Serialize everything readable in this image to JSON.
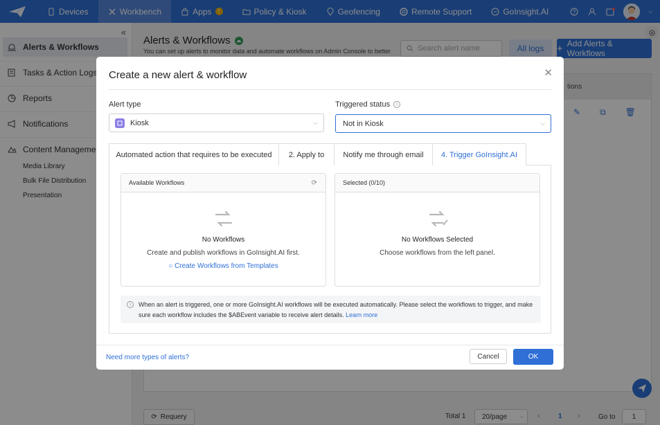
{
  "nav": {
    "items": [
      {
        "label": "Devices",
        "icon": "device-icon"
      },
      {
        "label": "Workbench",
        "icon": "tools-icon"
      },
      {
        "label": "Apps",
        "icon": "bag-icon",
        "badge": "!"
      },
      {
        "label": "Policy & Kiosk",
        "icon": "folder-icon"
      },
      {
        "label": "Geofencing",
        "icon": "location-icon"
      },
      {
        "label": "Remote Support",
        "icon": "support-icon"
      },
      {
        "label": "GoInsight.AI",
        "icon": "ai-icon"
      }
    ],
    "active_index": 1
  },
  "sidebar": {
    "items": [
      {
        "label": "Alerts & Workflows",
        "icon": "alert-icon"
      },
      {
        "label": "Tasks & Action Logs",
        "icon": "tasks-icon"
      },
      {
        "label": "Reports",
        "icon": "reports-icon"
      },
      {
        "label": "Notifications",
        "icon": "megaphone-icon"
      },
      {
        "label": "Content Management",
        "icon": "content-icon"
      }
    ],
    "sub_items": [
      "Media Library",
      "Bulk File Distribution",
      "Presentation"
    ]
  },
  "main": {
    "title": "Alerts & Workflows",
    "description": "You can set up alerts to monitor data and automate workflows on Admin Console to better",
    "search_placeholder": "Search alert name",
    "all_logs_label": "All logs",
    "add_button_label": "Add Alerts & Workflows",
    "actions_header": "tions"
  },
  "pagination": {
    "requery_label": "Requery",
    "total_label": "Total 1",
    "page_size": "20/page",
    "current_page": "1",
    "goto_label": "Go to",
    "goto_value": "1"
  },
  "modal": {
    "title": "Create a new alert & workflow",
    "alert_type_label": "Alert type",
    "alert_type_value": "Kiosk",
    "triggered_status_label": "Triggered status",
    "triggered_status_value": "Not in Kiosk",
    "tabs": [
      "Automated action that requires to be executed",
      "2. Apply to",
      "Notify me through email",
      "4. Trigger GoInsight.AI"
    ],
    "active_tab": 3,
    "available": {
      "header": "Available Workflows",
      "empty_title": "No Workflows",
      "empty_desc": "Create and publish workflows in GoInsight.AI first.",
      "link": "Create Workflows from Templates"
    },
    "selected": {
      "header": "Selected (0/10)",
      "empty_title": "No Workflows Selected",
      "empty_desc": "Choose workflows from the left panel."
    },
    "info_text": "When an alert is triggered, one or more GoInsight.AI workflows will be executed automatically. Please select the workflows to trigger, and make sure each workflow includes the $ABEvent variable to receive alert details.",
    "learn_more": "Learn more",
    "need_more": "Need more types of alerts?",
    "cancel_label": "Cancel",
    "ok_label": "OK"
  },
  "colors": {
    "primary": "#2f6fd6",
    "nav_active": "#5687db",
    "badge": "#f5b400",
    "kiosk_icon": "#8b7ee6"
  }
}
